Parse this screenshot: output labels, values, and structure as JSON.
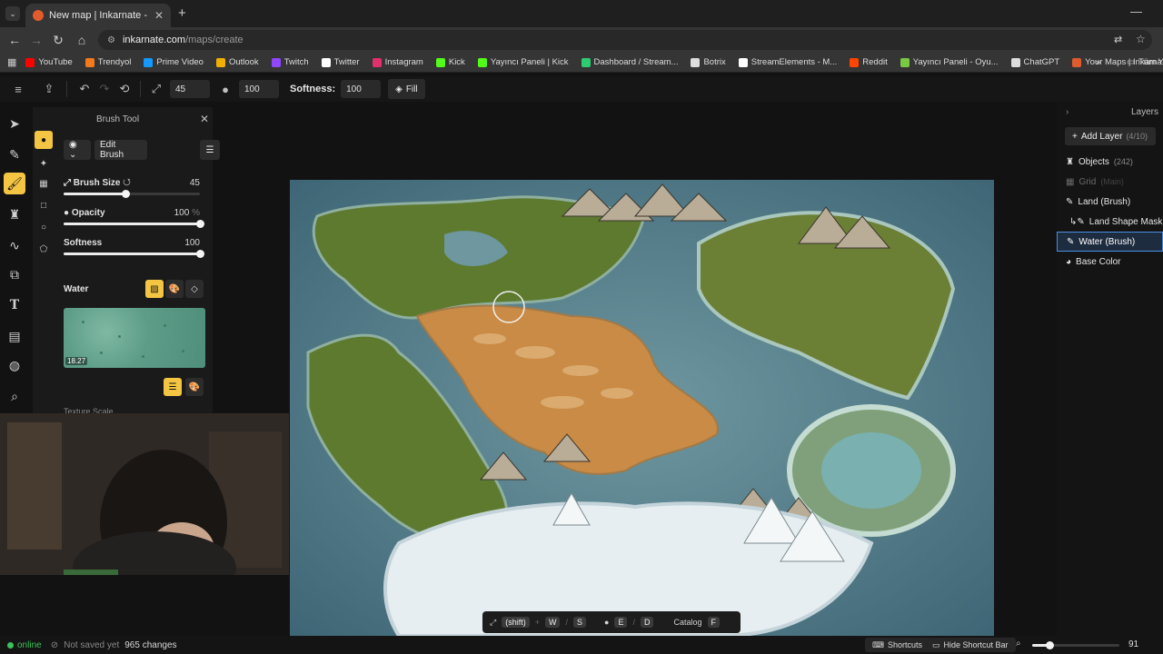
{
  "browser": {
    "tab_title": "New map | Inkarnate - Create F",
    "url_domain": "inkarnate.com",
    "url_path": "/maps/create",
    "bookmarks": [
      {
        "label": "YouTube",
        "color": "#ff0000"
      },
      {
        "label": "Trendyol",
        "color": "#f27a1a"
      },
      {
        "label": "Prime Video",
        "color": "#1399ff"
      },
      {
        "label": "Outlook",
        "color": "#f0b000"
      },
      {
        "label": "Twitch",
        "color": "#9146ff"
      },
      {
        "label": "Twitter",
        "color": "#ffffff"
      },
      {
        "label": "Instagram",
        "color": "#e1306c"
      },
      {
        "label": "Kick",
        "color": "#53fc18"
      },
      {
        "label": "Yayıncı Paneli | Kick",
        "color": "#53fc18"
      },
      {
        "label": "Dashboard / Stream...",
        "color": "#2ecc71"
      },
      {
        "label": "Botrix",
        "color": "#dddddd"
      },
      {
        "label": "StreamElements - M...",
        "color": "#ffffff"
      },
      {
        "label": "Reddit",
        "color": "#ff4500"
      },
      {
        "label": "Yayıncı Paneli - Oyu...",
        "color": "#7ac943"
      },
      {
        "label": "ChatGPT",
        "color": "#dddddd"
      },
      {
        "label": "Your Maps | Inkarna...",
        "color": "#e25b2c"
      }
    ],
    "bookmarks_more": "»",
    "all_bookmarks": "Tüm Y"
  },
  "toolbar": {
    "size_value": "45",
    "opacity_value": "100",
    "softness_label": "Softness:",
    "softness_value": "100",
    "fill_label": "Fill"
  },
  "brush_panel": {
    "title": "Brush Tool",
    "edit_brush": "Edit Brush",
    "brush_size_label": "Brush Size",
    "brush_size_value": "45",
    "opacity_label": "Opacity",
    "opacity_value": "100",
    "opacity_unit": "%",
    "softness_label": "Softness",
    "softness_value": "100",
    "water_label": "Water",
    "texture_scale_badge": "18.27",
    "texture_scale_label": "Texture Scale",
    "brush_size_fraction": 0.45,
    "opacity_fraction": 1.0,
    "softness_fraction": 1.0
  },
  "layers": {
    "title": "Layers",
    "add_layer": "Add Layer",
    "add_layer_count": "(4/10)",
    "items": [
      {
        "label": "Objects",
        "count": "(242)"
      },
      {
        "label": "Grid",
        "count": "(Main)"
      },
      {
        "label": "Land (Brush)",
        "count": ""
      },
      {
        "label": "Land Shape Mask",
        "count": ""
      },
      {
        "label": "Water (Brush)",
        "count": ""
      },
      {
        "label": "Base Color",
        "count": ""
      }
    ]
  },
  "shortcut_bar": {
    "shift": "(shift)",
    "w": "W",
    "s": "S",
    "e": "E",
    "d": "D",
    "catalog": "Catalog",
    "f": "F"
  },
  "status": {
    "online": "online",
    "saved": "Not saved yet",
    "changes": "965 changes",
    "shortcuts": "Shortcuts",
    "hide_shortcut_bar": "Hide Shortcut Bar",
    "zoom": "91",
    "zoom_fraction": 0.2
  }
}
